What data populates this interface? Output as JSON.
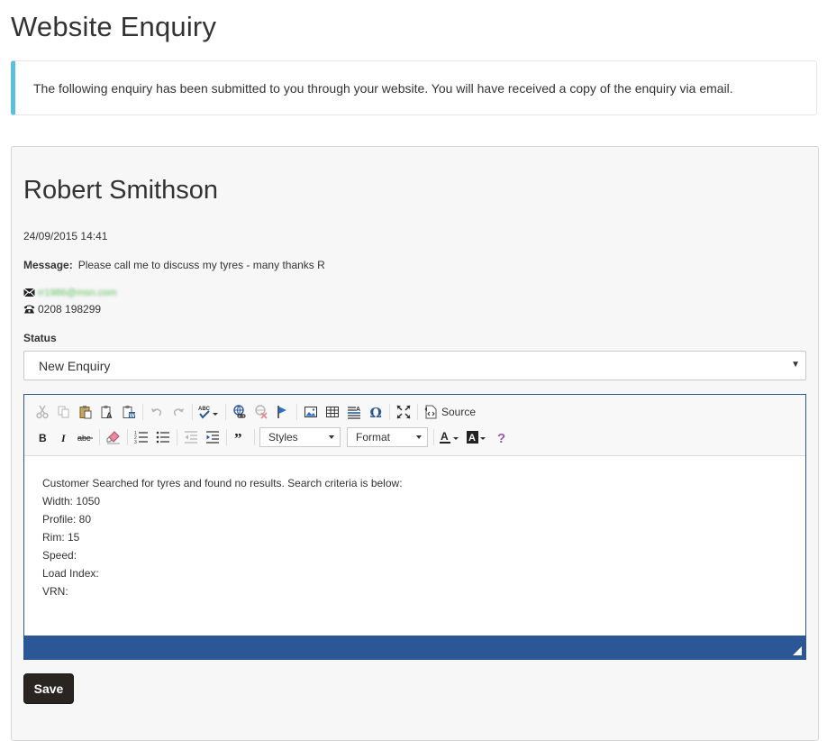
{
  "page": {
    "title": "Website Enquiry",
    "notice": "The following enquiry has been submitted to you through your website. You will have received a copy of the enquiry via email."
  },
  "enquiry": {
    "name": "Robert Smithson",
    "datetime": "24/09/2015 14:41",
    "message_label": "Message:",
    "message": "Please call me to discuss my tyres - many thanks R",
    "email": "rr1986@msn.com",
    "phone": "0208 198299"
  },
  "status": {
    "label": "Status",
    "selected": "New Enquiry"
  },
  "editor": {
    "toolbar": {
      "source_label": "Source",
      "styles_label": "Styles",
      "format_label": "Format"
    },
    "content_lines": [
      "Customer Searched for tyres and found no results. Search criteria is below:",
      "Width: 1050",
      "Profile: 80",
      "Rim: 15",
      "Speed:",
      "Load Index:",
      "VRN:"
    ]
  },
  "actions": {
    "save_label": "Save"
  },
  "colors": {
    "accent": "#5bc0de",
    "editor_bar": "#2b5797",
    "save_button": "#2a2520"
  }
}
